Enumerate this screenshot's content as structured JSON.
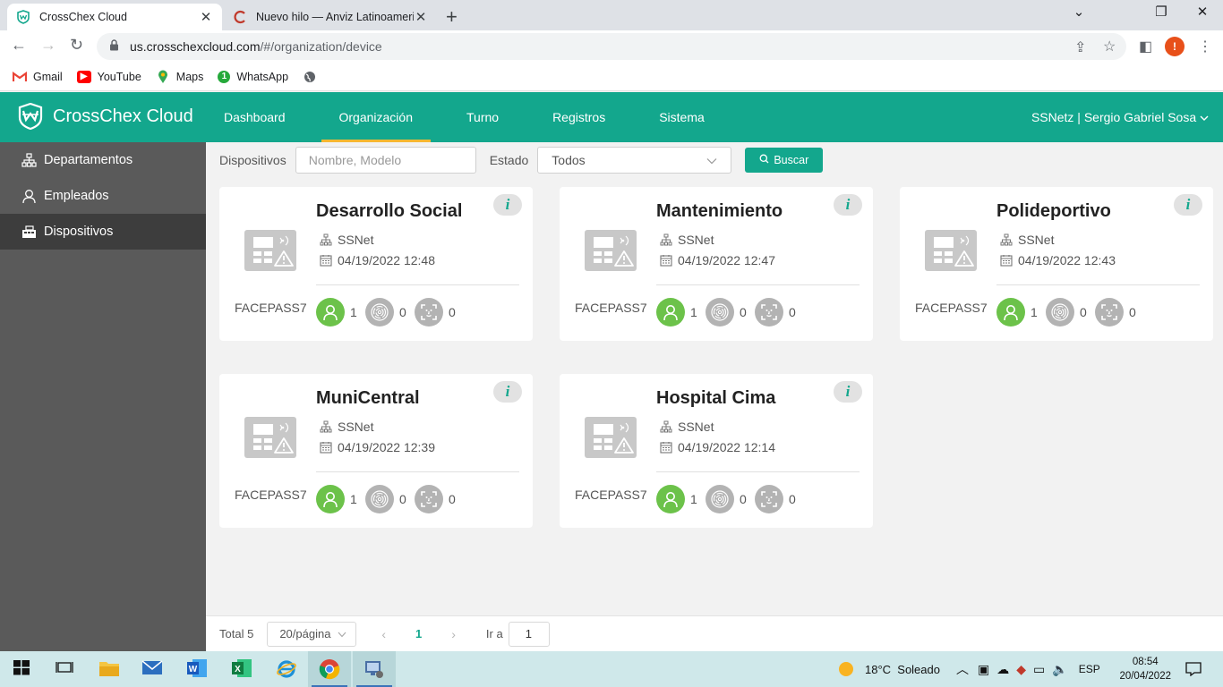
{
  "browser": {
    "tabs": [
      {
        "title": "CrossChex Cloud",
        "active": true
      },
      {
        "title": "Nuevo hilo — Anviz Latinoamericana",
        "active": false
      }
    ],
    "url_main": "us.crosschexcloud.com",
    "url_tail": "/#/organization/device",
    "profile_initial": "!",
    "bookmarks": [
      "Gmail",
      "YouTube",
      "Maps",
      "WhatsApp"
    ]
  },
  "app": {
    "brand": "CrossChex Cloud",
    "nav": [
      "Dashboard",
      "Organización",
      "Turno",
      "Registros",
      "Sistema"
    ],
    "nav_active": "Organización",
    "user": "SSNetz | Sergio Gabriel Sosa"
  },
  "sidebar": {
    "items": [
      {
        "label": "Departamentos",
        "icon": "org-chart-icon"
      },
      {
        "label": "Empleados",
        "icon": "user-icon"
      },
      {
        "label": "Dispositivos",
        "icon": "device-icon",
        "active": true
      }
    ]
  },
  "filters": {
    "devices_label": "Dispositivos",
    "search_placeholder": "Nombre, Modelo",
    "state_label": "Estado",
    "state_value": "Todos",
    "search_button": "Buscar"
  },
  "devices": [
    {
      "name": "Desarrollo Social",
      "org": "SSNet",
      "datetime": "04/19/2022 12:48",
      "model": "FACEPASS7",
      "users": "1",
      "fingerprints": "0",
      "faces": "0",
      "info": "i"
    },
    {
      "name": "Mantenimiento",
      "org": "SSNet",
      "datetime": "04/19/2022 12:47",
      "model": "FACEPASS7",
      "users": "1",
      "fingerprints": "0",
      "faces": "0",
      "info": "i"
    },
    {
      "name": "Polideportivo",
      "org": "SSNet",
      "datetime": "04/19/2022 12:43",
      "model": "FACEPASS7",
      "users": "1",
      "fingerprints": "0",
      "faces": "0",
      "info": "i"
    },
    {
      "name": "MuniCentral",
      "org": "SSNet",
      "datetime": "04/19/2022 12:39",
      "model": "FACEPASS7",
      "users": "1",
      "fingerprints": "0",
      "faces": "0",
      "info": "i"
    },
    {
      "name": "Hospital Cima",
      "org": "SSNet",
      "datetime": "04/19/2022 12:14",
      "model": "FACEPASS7",
      "users": "1",
      "fingerprints": "0",
      "faces": "0",
      "info": "i"
    }
  ],
  "pagination": {
    "total": "Total 5",
    "page_size": "20/página",
    "current_page": "1",
    "goto_label": "Ir a",
    "goto_value": "1"
  },
  "taskbar": {
    "weather": "18°C  Soleado",
    "lang": "ESP",
    "time": "08:54",
    "date": "20/04/2022"
  },
  "colors": {
    "accent": "#13a78d",
    "nav_active_underline": "#f7b731",
    "sidebar": "#5a5a5a",
    "sidebar_active": "#3d3d3d",
    "user_stat": "#6cc24a"
  }
}
